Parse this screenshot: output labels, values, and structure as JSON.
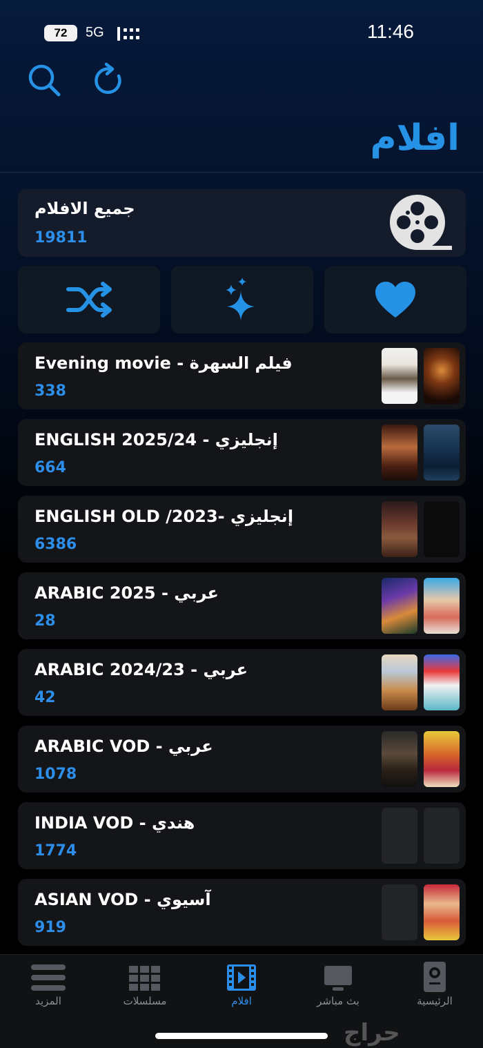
{
  "status_bar": {
    "battery": "72",
    "network": "5G",
    "time": "11:46"
  },
  "header": {
    "title": "افلام"
  },
  "all_movies": {
    "title": "جميع الافلام",
    "count": "19811"
  },
  "actions": [
    {
      "name": "shuffle",
      "icon": "shuffle-icon"
    },
    {
      "name": "new",
      "icon": "sparkles-icon"
    },
    {
      "name": "favorites",
      "icon": "heart-icon"
    }
  ],
  "categories": [
    {
      "title": "Evening movie - فيلم السهرة",
      "count": "338"
    },
    {
      "title": "ENGLISH 2025/24 - إنجليزي",
      "count": "664"
    },
    {
      "title": "ENGLISH OLD /2023- إنجليزي",
      "count": "6386"
    },
    {
      "title": "ARABIC 2025 - عربي",
      "count": "28"
    },
    {
      "title": "ARABIC 2024/23 - عربي",
      "count": "42"
    },
    {
      "title": "ARABIC VOD - عربي",
      "count": "1078"
    },
    {
      "title": "INDIA VOD - هندي",
      "count": "1774"
    },
    {
      "title": "ASIAN VOD - آسيوي",
      "count": "919"
    }
  ],
  "tabs": [
    {
      "label": "المزيد",
      "icon": "menu-icon",
      "active": false
    },
    {
      "label": "مسلسلات",
      "icon": "grid-icon",
      "active": false
    },
    {
      "label": "افلام",
      "icon": "film-icon",
      "active": true
    },
    {
      "label": "بث مباشر",
      "icon": "tv-icon",
      "active": false
    },
    {
      "label": "الرئيسية",
      "icon": "home-device-icon",
      "active": false
    }
  ],
  "watermark": "حراج",
  "colors": {
    "accent": "#2592e6",
    "card": "#141518",
    "background": "#000000"
  }
}
